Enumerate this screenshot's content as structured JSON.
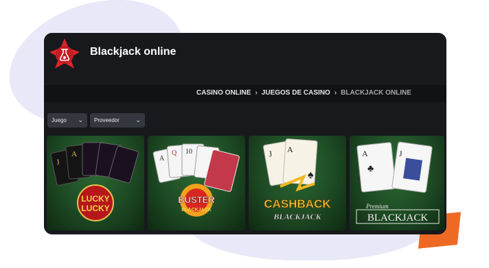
{
  "header": {
    "title": "Blackjack online"
  },
  "breadcrumb": [
    {
      "label": "CASINO ONLINE"
    },
    {
      "label": "JUEGOS DE CASINO"
    },
    {
      "label": "BLACKJACK ONLINE"
    }
  ],
  "filters": [
    {
      "label": "Juego"
    },
    {
      "label": "Proveedor"
    }
  ],
  "games": [
    {
      "logo_lines": [
        "LUCKY",
        "LUCKY"
      ]
    },
    {
      "logo_lines": [
        "BUSTER",
        "BLACKJACK"
      ]
    },
    {
      "logo_lines": [
        "CASHBACK",
        "BLACKJACK"
      ]
    },
    {
      "logo_lines": [
        "Premium",
        "BLACKJACK"
      ]
    }
  ],
  "colors": {
    "accent": "#ee6a24",
    "logo_red": "#d9252b",
    "window_bg": "#17191d"
  }
}
